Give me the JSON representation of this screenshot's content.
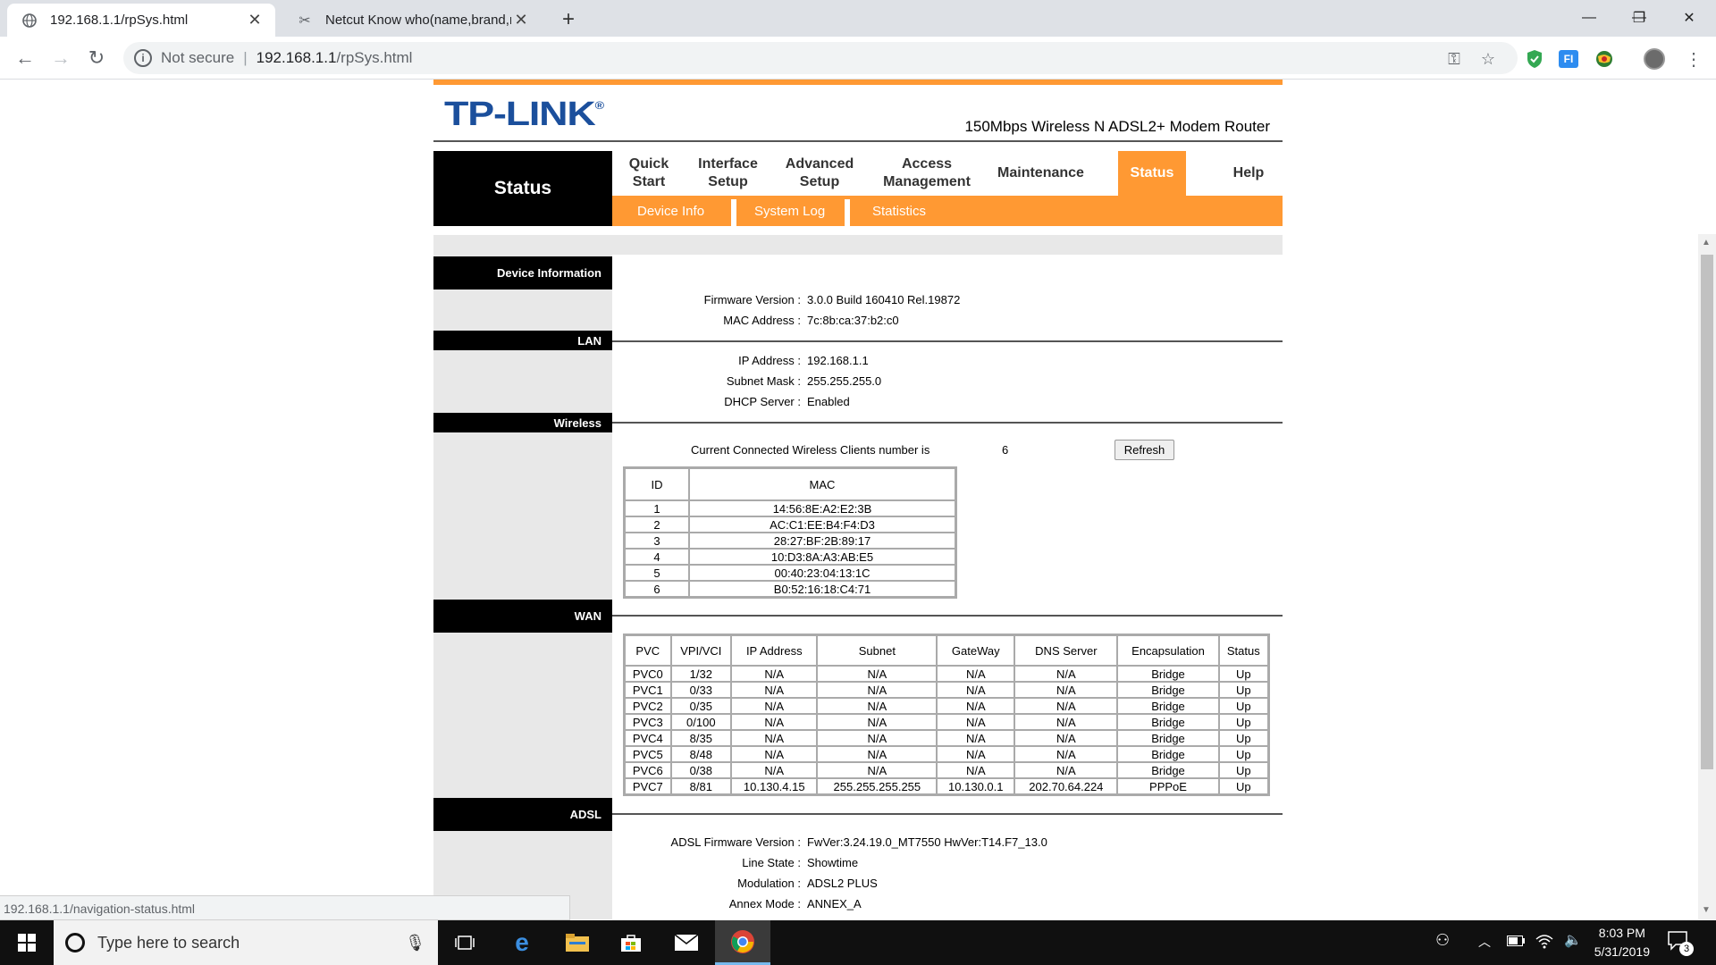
{
  "browser": {
    "tabs": [
      {
        "title": "192.168.1.1/rpSys.html",
        "active": true
      },
      {
        "title": "Netcut Know who(name,brand,m",
        "active": false
      }
    ],
    "omnibox": {
      "security": "Not secure",
      "host": "192.168.1.1",
      "path": "/rpSys.html"
    },
    "status_url": "192.168.1.1/navigation-status.html"
  },
  "router": {
    "logo": "TP-LINK",
    "logo_mark": "®",
    "model": "150Mbps Wireless N ADSL2+ Modem Router",
    "section_title": "Status",
    "menu": [
      {
        "line1": "Quick",
        "line2": "Start"
      },
      {
        "line1": "Interface",
        "line2": "Setup"
      },
      {
        "line1": "Advanced",
        "line2": "Setup"
      },
      {
        "line1": "Access",
        "line2": "Management"
      },
      {
        "line1": "Maintenance",
        "line2": ""
      },
      {
        "line1": "Status",
        "line2": ""
      },
      {
        "line1": "Help",
        "line2": ""
      }
    ],
    "submenu": [
      "Device Info",
      "System Log",
      "Statistics"
    ],
    "device_info": {
      "title": "Device Information",
      "firmware_label": "Firmware Version",
      "firmware_value": "3.0.0 Build 160410 Rel.19872",
      "mac_label": "MAC Address",
      "mac_value": "7c:8b:ca:37:b2:c0"
    },
    "lan": {
      "title": "LAN",
      "ip_label": "IP Address",
      "ip_value": "192.168.1.1",
      "mask_label": "Subnet Mask",
      "mask_value": "255.255.255.0",
      "dhcp_label": "DHCP Server",
      "dhcp_value": "Enabled"
    },
    "wireless": {
      "title": "Wireless",
      "clients_label": "Current Connected Wireless Clients number is",
      "clients_count": "6",
      "refresh_label": "Refresh",
      "table_headers": [
        "ID",
        "MAC"
      ],
      "clients": [
        [
          "1",
          "14:56:8E:A2:E2:3B"
        ],
        [
          "2",
          "AC:C1:EE:B4:F4:D3"
        ],
        [
          "3",
          "28:27:BF:2B:89:17"
        ],
        [
          "4",
          "10:D3:8A:A3:AB:E5"
        ],
        [
          "5",
          "00:40:23:04:13:1C"
        ],
        [
          "6",
          "B0:52:16:18:C4:71"
        ]
      ]
    },
    "wan": {
      "title": "WAN",
      "headers": [
        "PVC",
        "VPI/VCI",
        "IP Address",
        "Subnet",
        "GateWay",
        "DNS Server",
        "Encapsulation",
        "Status"
      ],
      "rows": [
        [
          "PVC0",
          "1/32",
          "N/A",
          "N/A",
          "N/A",
          "N/A",
          "Bridge",
          "Up"
        ],
        [
          "PVC1",
          "0/33",
          "N/A",
          "N/A",
          "N/A",
          "N/A",
          "Bridge",
          "Up"
        ],
        [
          "PVC2",
          "0/35",
          "N/A",
          "N/A",
          "N/A",
          "N/A",
          "Bridge",
          "Up"
        ],
        [
          "PVC3",
          "0/100",
          "N/A",
          "N/A",
          "N/A",
          "N/A",
          "Bridge",
          "Up"
        ],
        [
          "PVC4",
          "8/35",
          "N/A",
          "N/A",
          "N/A",
          "N/A",
          "Bridge",
          "Up"
        ],
        [
          "PVC5",
          "8/48",
          "N/A",
          "N/A",
          "N/A",
          "N/A",
          "Bridge",
          "Up"
        ],
        [
          "PVC6",
          "0/38",
          "N/A",
          "N/A",
          "N/A",
          "N/A",
          "Bridge",
          "Up"
        ],
        [
          "PVC7",
          "8/81",
          "10.130.4.15",
          "255.255.255.255",
          "10.130.0.1",
          "202.70.64.224",
          "PPPoE",
          "Up"
        ]
      ]
    },
    "adsl": {
      "title": "ADSL",
      "fw_label": "ADSL Firmware Version",
      "fw_value": "FwVer:3.24.19.0_MT7550 HwVer:T14.F7_13.0",
      "state_label": "Line State",
      "state_value": "Showtime",
      "mod_label": "Modulation",
      "mod_value": "ADSL2 PLUS",
      "annex_label": "Annex Mode",
      "annex_value": "ANNEX_A"
    }
  },
  "taskbar": {
    "search_placeholder": "Type here to search",
    "time": "8:03 PM",
    "date": "5/31/2019",
    "notification_count": "3"
  },
  "colors": {
    "accent_orange": "#ff9933",
    "logo_blue": "#1b4f9c",
    "chrome_tabstrip": "#dee1e6"
  }
}
